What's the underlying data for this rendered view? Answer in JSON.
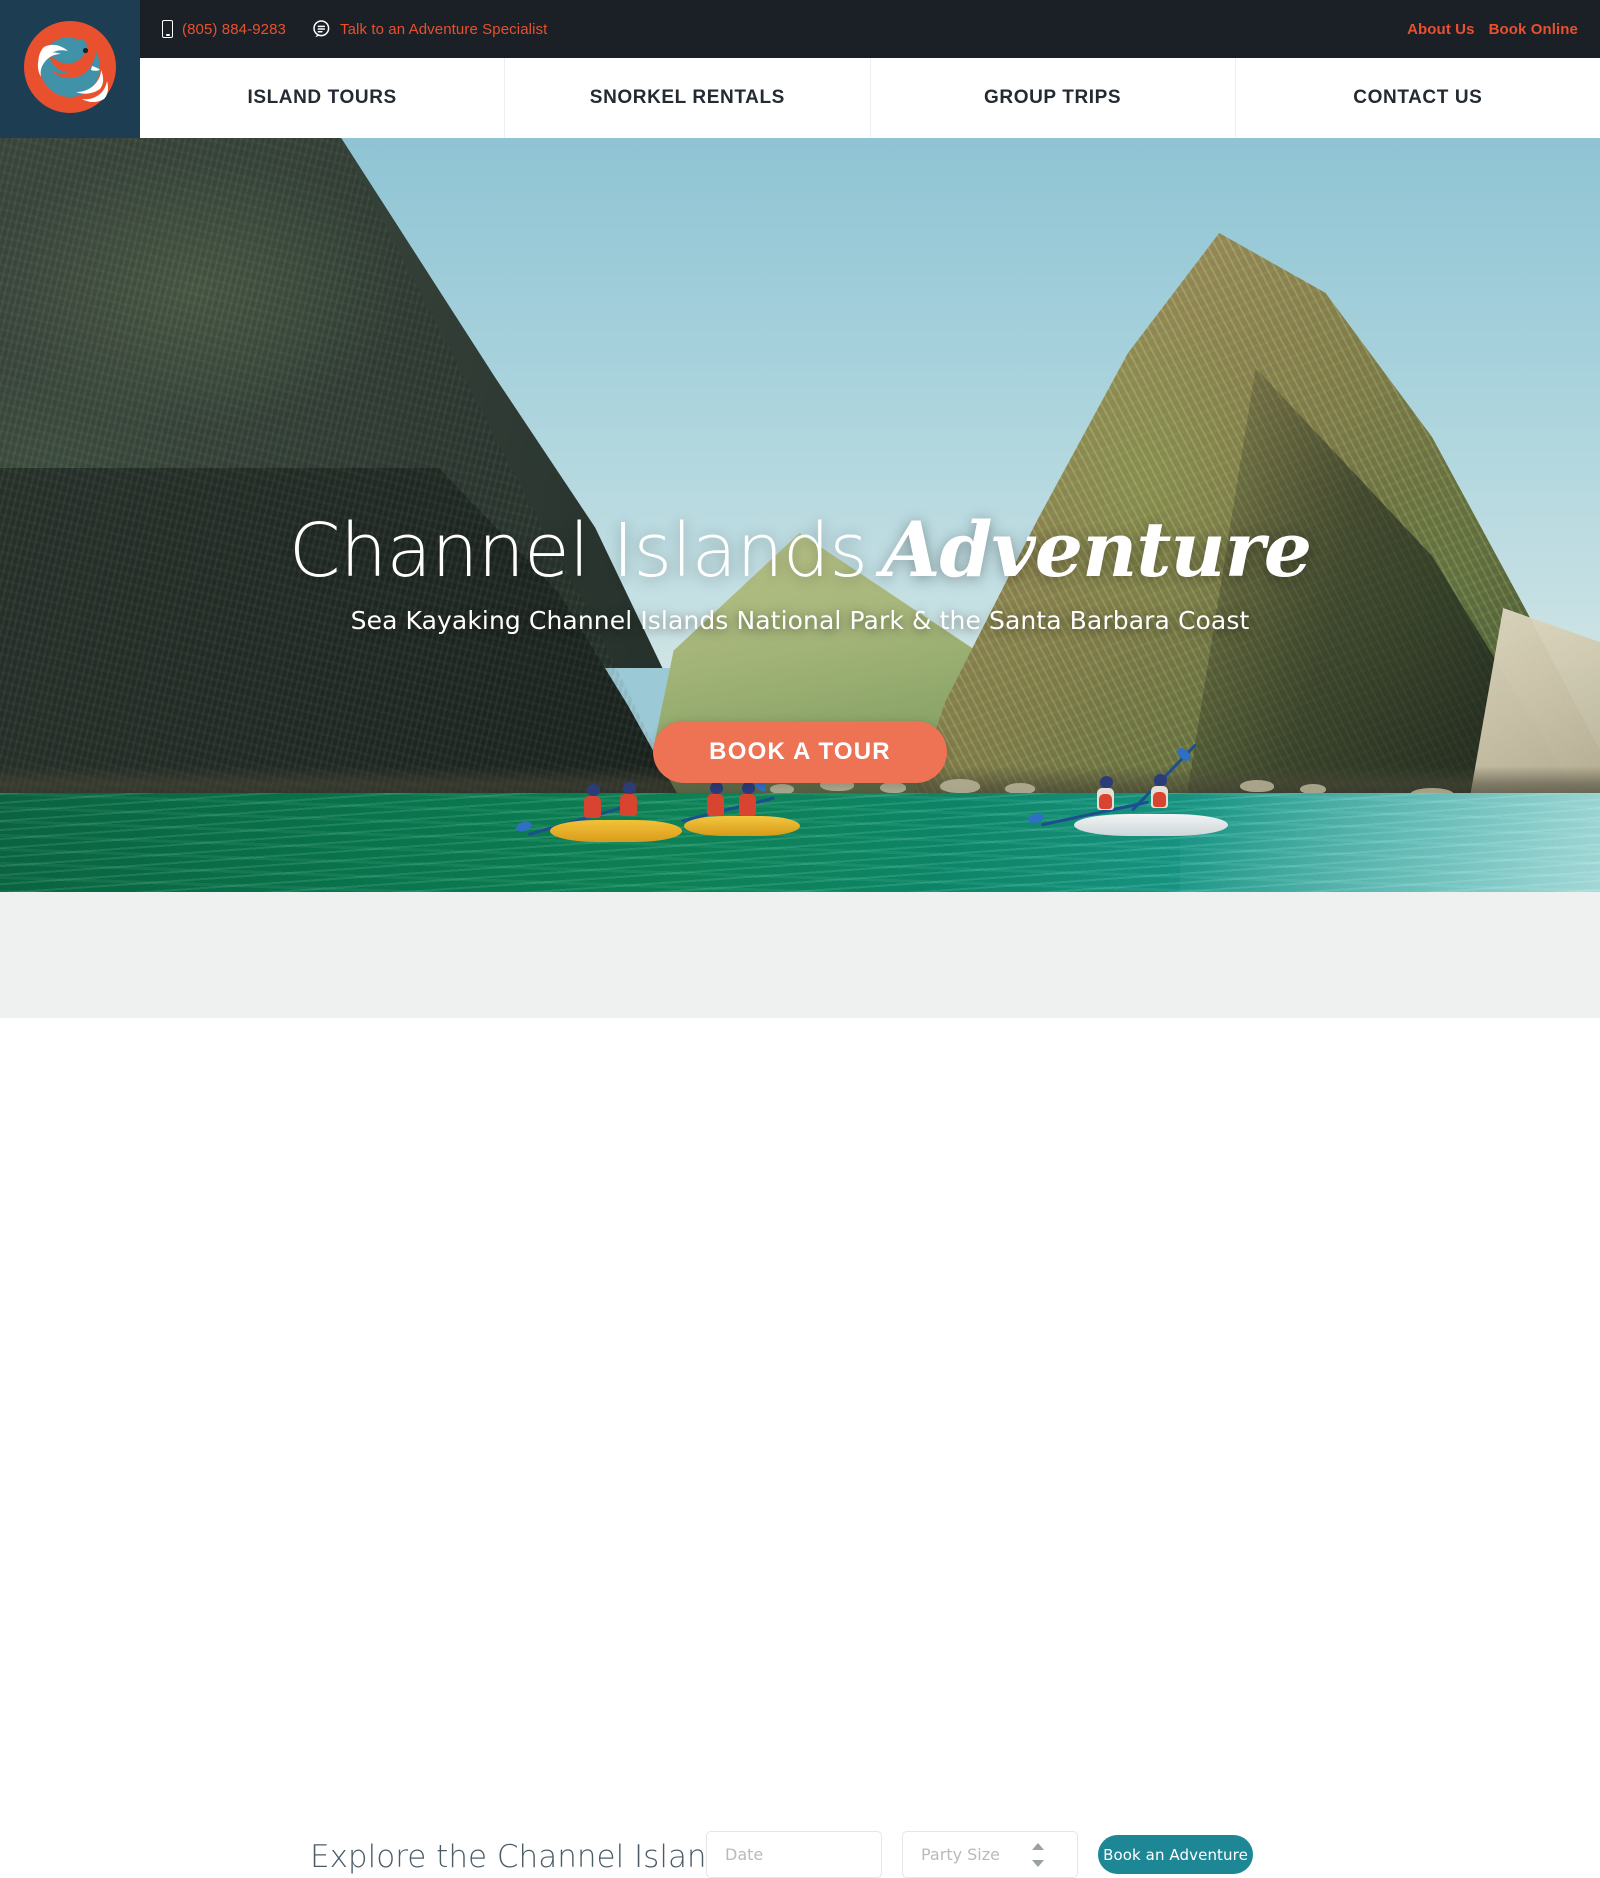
{
  "brand": {
    "logo_icon": "fox-fish-logo-icon",
    "logo_bg": "#1d3d52",
    "logo_orange": "#e8502e",
    "logo_teal": "#3f92a8"
  },
  "topbar": {
    "bg": "#1b2027",
    "accent": "#e8502e",
    "phone_icon": "mobile-phone-icon",
    "phone": "(805) 884-9283",
    "chat_icon": "chat-bubble-icon",
    "chat_label": "Talk to an Adventure Specialist",
    "about_label": "About Us",
    "book_online_label": "Book Online"
  },
  "nav": {
    "items": [
      {
        "label": "ISLAND TOURS"
      },
      {
        "label": "SNORKEL RENTALS"
      },
      {
        "label": "GROUP TRIPS"
      },
      {
        "label": "CONTACT US"
      }
    ]
  },
  "hero": {
    "title_light": "Channel Islands",
    "title_script": "Adventure",
    "subtitle": "Sea Kayaking Channel Islands National Park & the Santa Barbara Coast",
    "cta_label": "BOOK A TOUR",
    "cta_color": "#ee7254",
    "scene": "sea-kayakers-below-island-cliffs"
  },
  "explore": {
    "bg": "#eff0f0",
    "heading": "Explore the Channel Islands",
    "date_placeholder": "Date",
    "date_value": "",
    "party_placeholder": "Party Size",
    "party_value": "",
    "stepper_icon": "up-down-stepper-icon",
    "submit_label": "Book an Adventure",
    "submit_color": "#1e8795"
  }
}
